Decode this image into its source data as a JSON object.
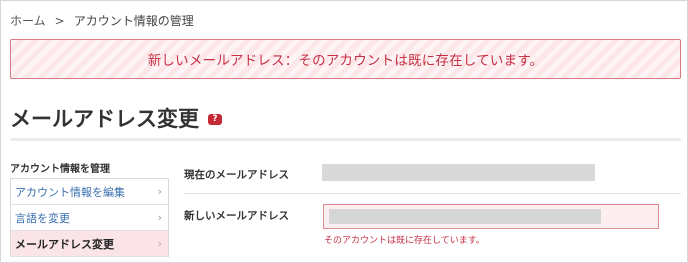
{
  "breadcrumb": {
    "home": "ホーム",
    "separator": ">",
    "current": "アカウント情報の管理"
  },
  "alert": {
    "message": "新しいメールアドレス：そのアカウントは既に存在しています。"
  },
  "page": {
    "title": "メールアドレス変更",
    "help_label": "?"
  },
  "sidebar": {
    "heading": "アカウント情報を管理",
    "items": [
      {
        "label": "アカウント情報を編集",
        "chevron": "›"
      },
      {
        "label": "言語を変更",
        "chevron": "›"
      },
      {
        "label": "メールアドレス変更",
        "chevron": "›",
        "active": true
      }
    ]
  },
  "form": {
    "current_label": "現在のメールアドレス",
    "new_label": "新しいメールアドレス",
    "new_value": "",
    "error": "そのアカウントは既に存在しています。"
  },
  "colors": {
    "error_text": "#c62f44",
    "error_bg": "#fde6e8",
    "active_item_bg": "#fbe4e7",
    "link": "#3a6fb0",
    "help_badge": "#c62936"
  },
  "icons": {
    "help": "question-badge-icon",
    "chevron": "chevron-right-icon"
  }
}
